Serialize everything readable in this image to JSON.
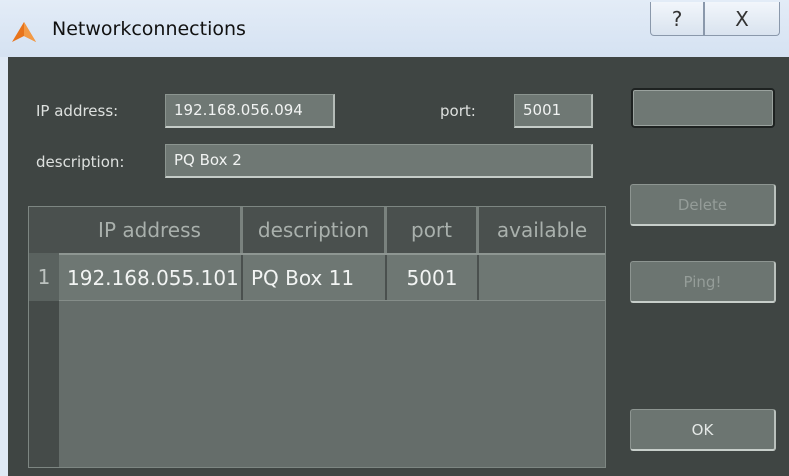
{
  "window": {
    "title": "Networkconnections",
    "help_glyph": "?",
    "close_glyph": "X"
  },
  "form": {
    "ip_label": "IP address:",
    "ip_value": "192.168.056.094",
    "port_label": "port:",
    "port_value": "5001",
    "description_label": "description:",
    "description_value": "PQ Box 2"
  },
  "buttons": {
    "top_label": "",
    "delete_label": "Delete",
    "ping_label": "Ping!",
    "ok_label": "OK"
  },
  "table": {
    "columns": [
      "IP address",
      "description",
      "port",
      "available"
    ],
    "rows": [
      {
        "index": "1",
        "ip": "192.168.055.101",
        "description": "PQ Box 11",
        "port": "5001",
        "available": ""
      }
    ]
  },
  "colors": {
    "dialog_bg": "#3f4543",
    "field_bg": "#6f7874",
    "titlebar_bg": "#dfe9f5",
    "icon_orange": "#e8741c"
  }
}
